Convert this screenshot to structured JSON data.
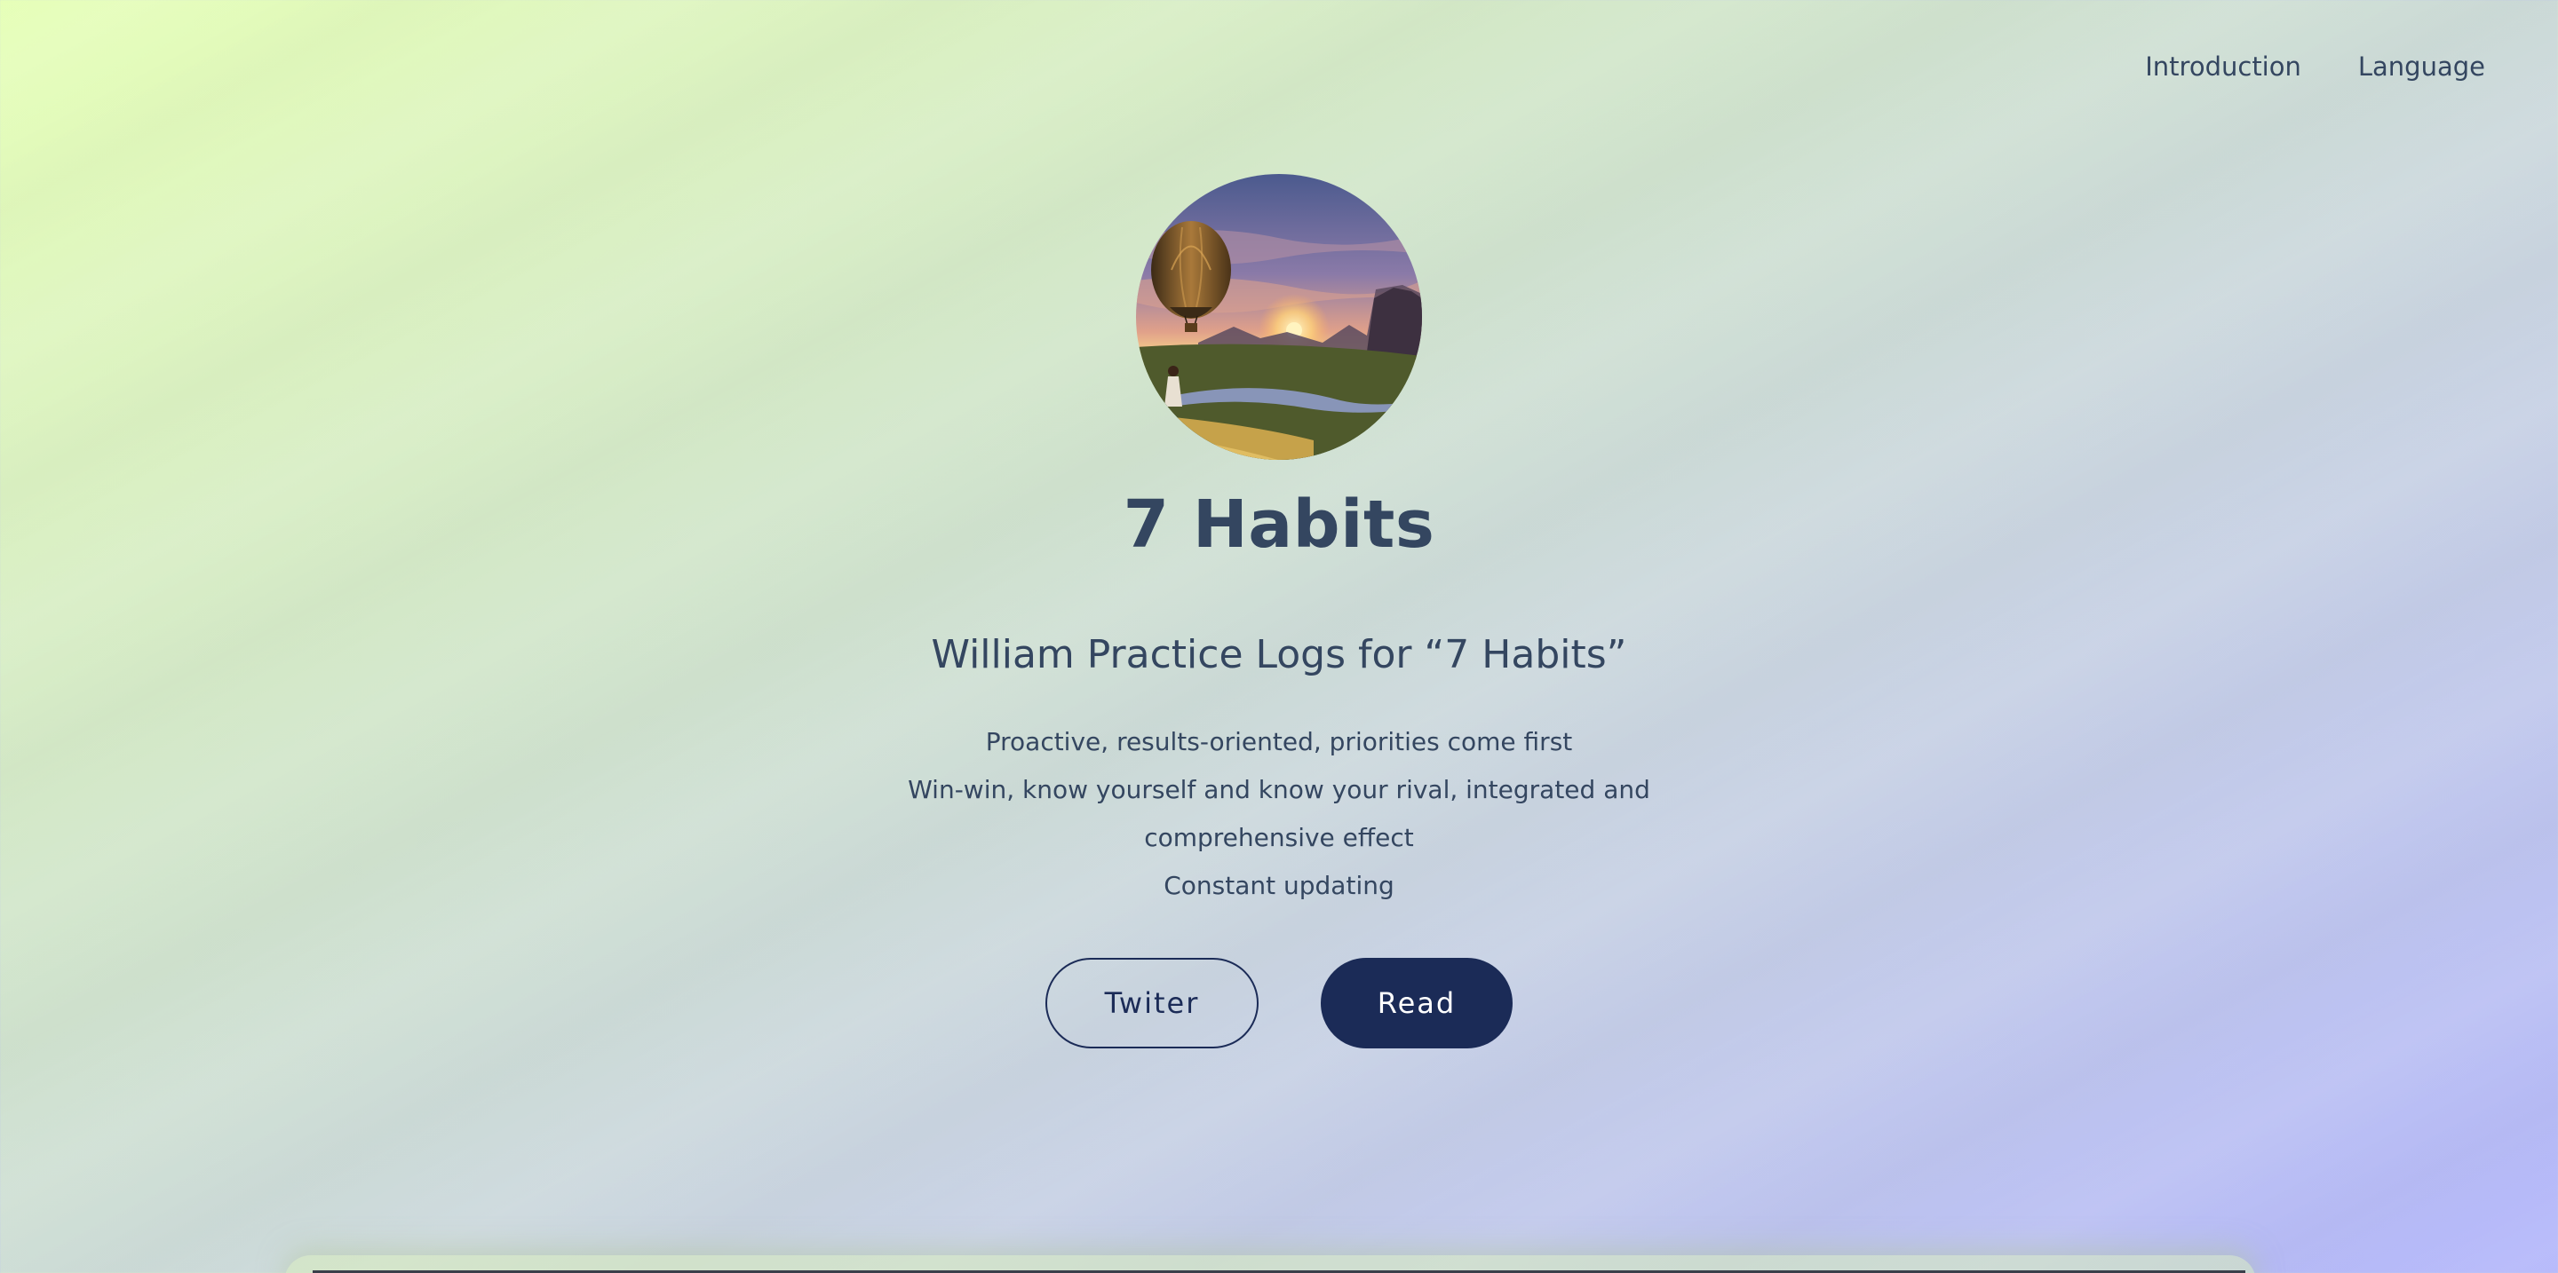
{
  "nav": {
    "items": [
      {
        "label": "Introduction"
      },
      {
        "label": "Language"
      }
    ]
  },
  "hero": {
    "avatar_icon": "hot-air-balloon-sunset-image",
    "title": "7 Habits",
    "subtitle": "William Practice Logs for “7 Habits”",
    "description": [
      "Proactive, results-oriented, priorities come first",
      "Win-win, know yourself and know your rival, integrated and comprehensive effect",
      "Constant updating"
    ],
    "buttons": {
      "twitter_label": "Twiter",
      "read_label": "Read"
    }
  },
  "colors": {
    "text": "#344660",
    "primary": "#1b2b57",
    "gradient_start": "#e6ffb8",
    "gradient_end": "#b4b7fb"
  }
}
